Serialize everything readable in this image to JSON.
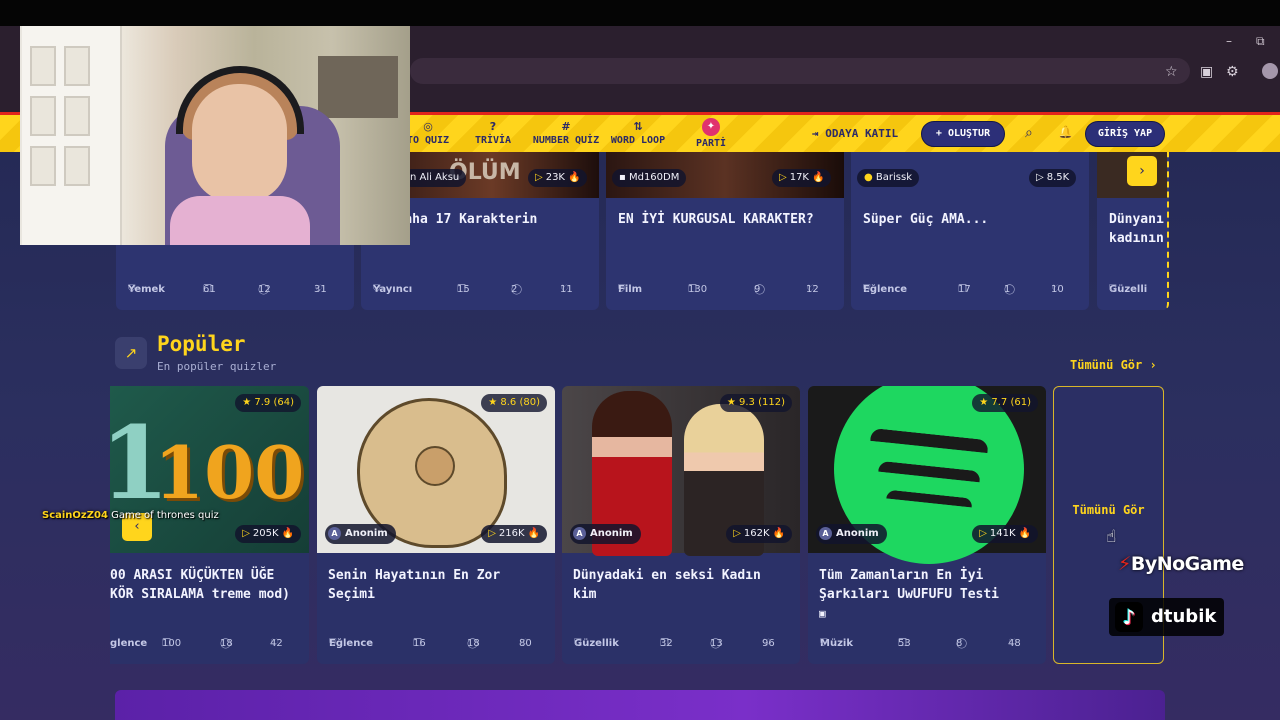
{
  "browser": {
    "minimize": "–",
    "restore": "⧉",
    "star_icon": "☆",
    "ext_icons": [
      "▣",
      "⚙"
    ]
  },
  "nav": {
    "items": [
      {
        "label": "TO QUIZ",
        "icon": "camera-icon",
        "glyph": "◎"
      },
      {
        "label": "TRİVİA",
        "icon": "question-icon",
        "glyph": "?"
      },
      {
        "label": "NUMBER QUİZ",
        "icon": "hash-icon",
        "glyph": "#"
      },
      {
        "label": "WORD LOOP",
        "icon": "sort-icon",
        "glyph": "⇅"
      },
      {
        "label": "PARTİ",
        "icon": "party-icon",
        "glyph": "✦"
      }
    ],
    "join_label": "ODAYA KATIL",
    "join_glyph": "⇥",
    "create_label": "+ OLUŞTUR",
    "search_glyph": "⌕",
    "bell_glyph": "🔔",
    "login_label": "GİRİŞ YAP"
  },
  "top_row": [
    {
      "author": "",
      "plays": "",
      "title": "",
      "category": "Yemek",
      "questions": "61",
      "comments": "12",
      "likes": "31"
    },
    {
      "author": "n Ali Aksu",
      "plays": "23K",
      "thumb_text": "ÖLÜM",
      "title": "ri Daha 17 Karakterin",
      "category": "Yayıncı",
      "questions": "15",
      "comments": "2",
      "likes": "11"
    },
    {
      "author": "Md160DM",
      "plays": "17K",
      "title": "EN İYİ KURGUSAL KARAKTER?",
      "category": "Film",
      "questions": "130",
      "comments": "9",
      "likes": "12"
    },
    {
      "author": "Barissk",
      "plays": "8.5K",
      "title": "Süper Güç AMA...",
      "category": "Eğlence",
      "questions": "17",
      "comments": "1",
      "likes": "10"
    },
    {
      "author": "",
      "plays": "",
      "title": "Dünyanı kadının",
      "category": "Güzelli",
      "questions": "",
      "comments": "",
      "likes": ""
    }
  ],
  "top_next_glyph": "›",
  "popular": {
    "title": "Popüler",
    "subtitle": "En popüler quizler",
    "see_all": "Tümünü Gör ›",
    "see_all_card": "Tümünü Gör",
    "prev_glyph": "‹",
    "cards": [
      {
        "rating": "★ 7.9 (64)",
        "author": "",
        "plays": "205K",
        "image_text": "100",
        "title": "00 ARASI KÜÇÜKTEN ÜĞE KÖR SIRALAMA treme mod)",
        "category": "glence",
        "questions": "100",
        "comments": "18",
        "likes": "42",
        "img_bg": "#1f5a4b"
      },
      {
        "rating": "★ 8.6 (80)",
        "author": "Anonim",
        "plays": "216K",
        "title": "Senin Hayatının En Zor Seçimi",
        "category": "Eğlence",
        "questions": "16",
        "comments": "18",
        "likes": "80",
        "img_bg": "#e7e6e2"
      },
      {
        "rating": "★ 9.3 (112)",
        "author": "Anonim",
        "plays": "162K",
        "title": "Dünyadaki en seksi Kadın kim",
        "category": "Güzellik",
        "questions": "32",
        "comments": "13",
        "likes": "96",
        "img_bg": "#3a3436"
      },
      {
        "rating": "★ 7.7 (61)",
        "author": "Anonim",
        "plays": "141K",
        "title": "Tüm Zamanların En İyi Şarkıları UwUFUFU Testi",
        "category": "Müzik",
        "questions": "53",
        "comments": "8",
        "likes": "48",
        "img_bg": "#1a1a1a",
        "accent": "#1ed760"
      }
    ]
  },
  "overlay": {
    "chat_user": "ScainOzZ04",
    "chat_msg": "Game of thrones quiz",
    "brand": "ByNoGame",
    "brand_mark": "⚡",
    "tiktok_name": "dtubik",
    "tiktok_glyph": "♪"
  }
}
